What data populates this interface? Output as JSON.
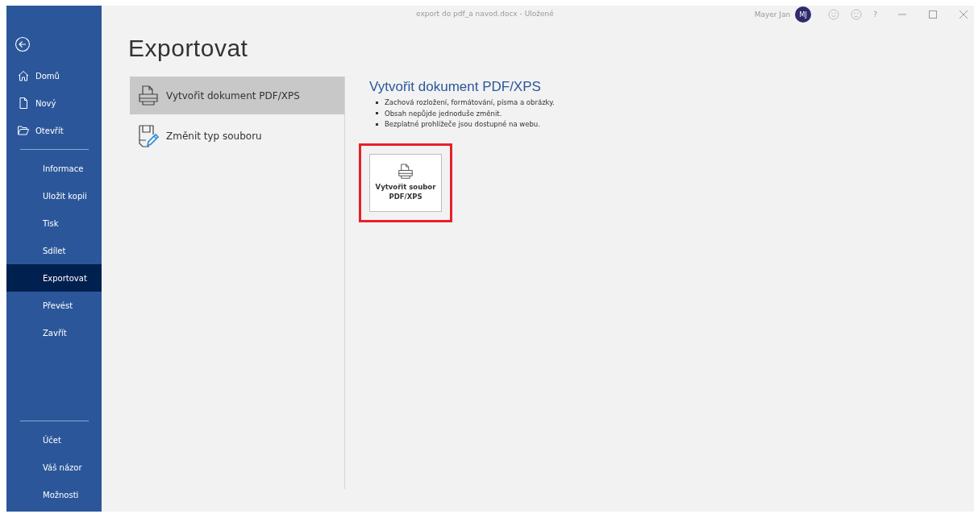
{
  "title_bar": {
    "document": "export do pdf_a navod.docx  -  Uložené",
    "user_name": "Mayer Jan",
    "avatar_initials": "MJ",
    "help": "?"
  },
  "sidebar": {
    "top_items": [
      {
        "label": "Domů",
        "kind": "home",
        "selected": false
      },
      {
        "label": "Nový",
        "kind": "page",
        "selected": false
      },
      {
        "label": "Otevřít",
        "kind": "folder",
        "selected": false
      }
    ],
    "items": [
      {
        "label": "Informace",
        "selected": false
      },
      {
        "label": "Uložit kopii",
        "selected": false
      },
      {
        "label": "Tisk",
        "selected": false
      },
      {
        "label": "Sdílet",
        "selected": false
      },
      {
        "label": "Exportovat",
        "selected": true
      },
      {
        "label": "Převést",
        "selected": false
      },
      {
        "label": "Zavřít",
        "selected": false
      }
    ],
    "bottom_items": [
      {
        "label": "Účet",
        "selected": false
      },
      {
        "label": "Váš názor",
        "selected": false
      },
      {
        "label": "Možnosti",
        "selected": false
      }
    ]
  },
  "page_title": "Exportovat",
  "options": [
    {
      "label": "Vytvořit dokument PDF/XPS",
      "kind": "printer",
      "selected": true
    },
    {
      "label": "Změnit typ souboru",
      "kind": "file-pen",
      "selected": false
    }
  ],
  "detail": {
    "heading": "Vytvořit dokument PDF/XPS",
    "bullets": [
      "Zachová rozložení, formátování, písma a obrázky.",
      "Obsah nepůjde jednoduše změnit.",
      "Bezplatné prohlížeče jsou dostupné na webu."
    ],
    "button": {
      "label_lines": [
        "Vytvořit soubor",
        "PDF/XPS"
      ],
      "highlighted": true
    }
  }
}
